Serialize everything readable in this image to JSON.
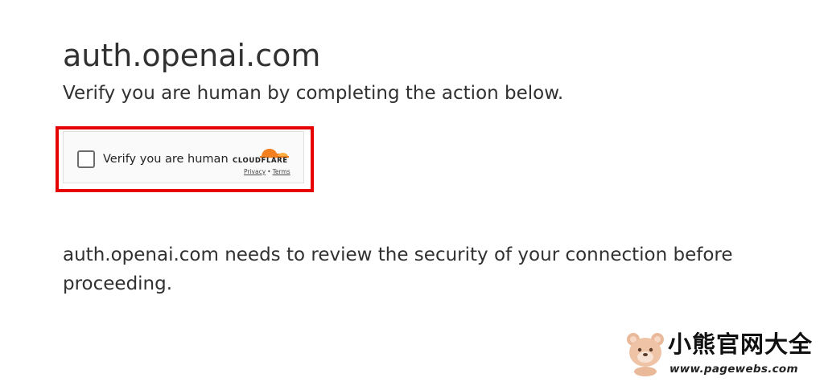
{
  "header": {
    "domain": "auth.openai.com",
    "subtitle": "Verify you are human by completing the action below."
  },
  "challenge": {
    "checkbox_label": "Verify you are human",
    "checked": false,
    "provider_logo_text": "CLOUDFLARE",
    "privacy_link": "Privacy",
    "separator": "•",
    "terms_link": "Terms",
    "highlight_color": "#e60000",
    "brand_color": "#f38020"
  },
  "body": {
    "security_message": "auth.openai.com needs to review the security of your connection before proceeding."
  },
  "watermark": {
    "title": "小熊官网大全",
    "url": "www.pagewebs.com",
    "icon": "bear-icon"
  }
}
